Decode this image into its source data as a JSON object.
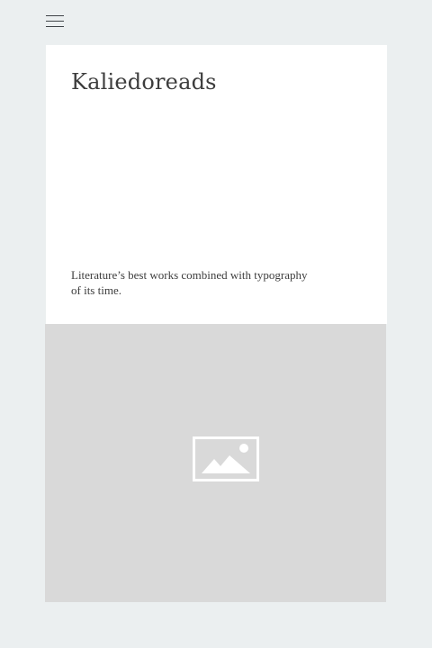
{
  "header": {
    "menu_icon": "hamburger-menu-icon"
  },
  "card": {
    "site_title": "Kaliedoreads",
    "tagline": "Literature’s best works combined with typography of its time."
  },
  "featured_image": {
    "icon": "image-placeholder-icon",
    "background_color": "#d9d9d9",
    "icon_color": "#ffffff"
  },
  "colors": {
    "page_background": "#ebeff0",
    "card_background": "#ffffff",
    "text": "#3d3d3d"
  }
}
